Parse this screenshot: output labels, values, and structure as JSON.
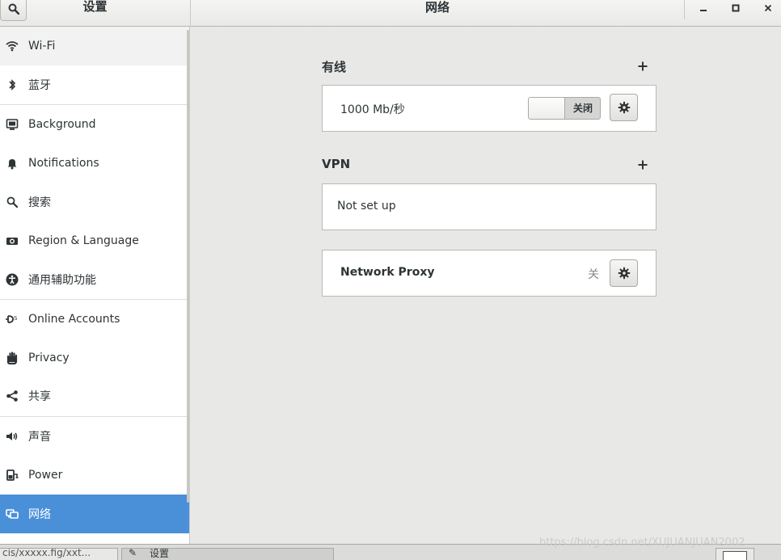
{
  "header": {
    "left_title": "设置",
    "main_title": "网络"
  },
  "sidebar": {
    "items": [
      {
        "label": "Wi-Fi",
        "icon": "wifi-icon"
      },
      {
        "label": "蓝牙",
        "icon": "bluetooth-icon"
      },
      {
        "label": "Background",
        "icon": "background-icon"
      },
      {
        "label": "Notifications",
        "icon": "bell-icon"
      },
      {
        "label": "搜索",
        "icon": "search-icon"
      },
      {
        "label": "Region & Language",
        "icon": "camera-icon"
      },
      {
        "label": "通用辅助功能",
        "icon": "accessibility-icon"
      },
      {
        "label": "Online Accounts",
        "icon": "online-accounts-icon"
      },
      {
        "label": "Privacy",
        "icon": "hand-icon"
      },
      {
        "label": "共享",
        "icon": "share-icon"
      },
      {
        "label": "声音",
        "icon": "speaker-icon"
      },
      {
        "label": "Power",
        "icon": "power-icon"
      },
      {
        "label": "网络",
        "icon": "network-icon",
        "selected": true
      }
    ]
  },
  "wired": {
    "title": "有线",
    "speed": "1000 Mb/秒",
    "switch_state": "关闭"
  },
  "vpn": {
    "title": "VPN",
    "status": "Not set up"
  },
  "proxy": {
    "label": "Network Proxy",
    "status": "关"
  },
  "taskbar": {
    "item_path": "cis/xxxxx.fig/xxt...",
    "item_settings": "设置"
  },
  "watermark": "https://blog.csdn.net/XUJUANJUAN2002",
  "colors": {
    "accent": "#4a90d9",
    "sidebar_bg": "#ffffff",
    "main_bg": "#e8e8e7"
  }
}
